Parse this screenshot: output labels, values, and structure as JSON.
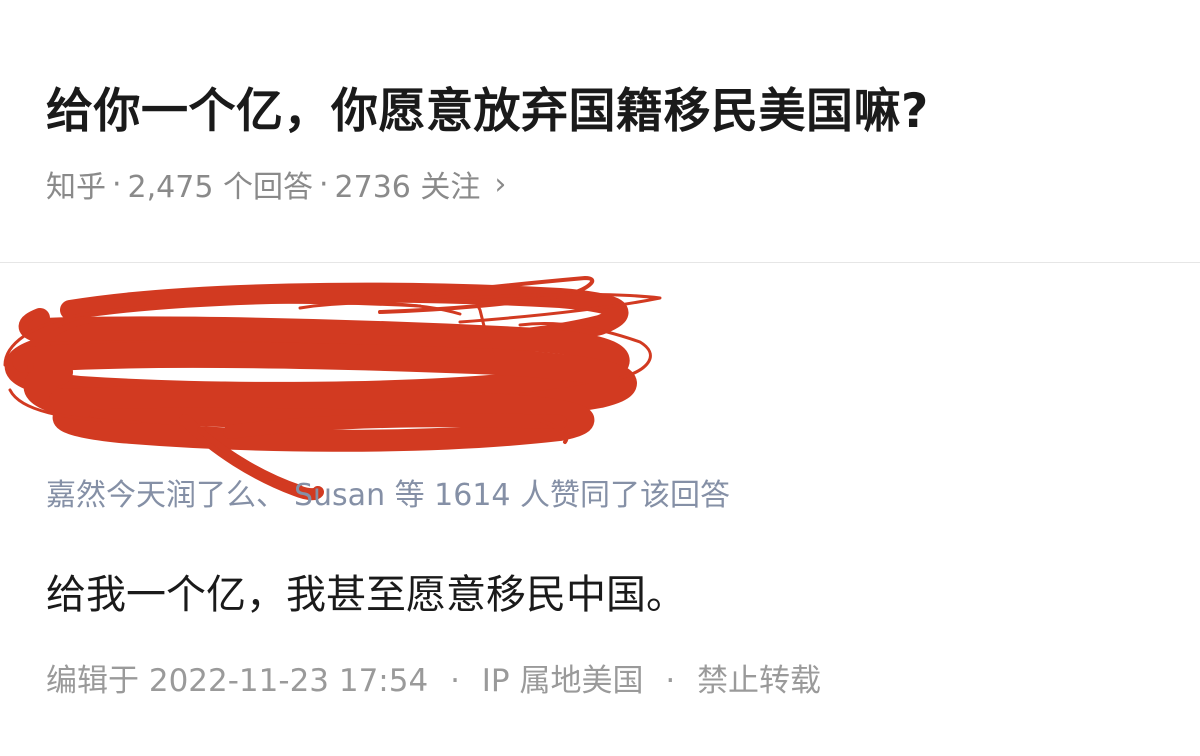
{
  "question": {
    "title": "给你一个亿，你愿意放弃国籍移民美国嘛?",
    "source": "知乎",
    "answers": "2,475 个回答",
    "followers": "2736 关注",
    "separator": "·",
    "chevron_icon": "chevron-right-icon"
  },
  "answer": {
    "voters_visible": "嘉然今天润了么、",
    "voters_named": "Susan 等 1614 人赞同了该回答",
    "content": "给我一个亿，我甚至愿意移民中国。",
    "edited": "编辑于 2022-11-23 17:54",
    "ip_location": "IP 属地美国",
    "copyright": "禁止转载",
    "separator": "·"
  },
  "colors": {
    "scribble": "#d23a21",
    "title": "#1a1a1a",
    "meta": "#8a8a8a",
    "voters": "#8590a6"
  }
}
